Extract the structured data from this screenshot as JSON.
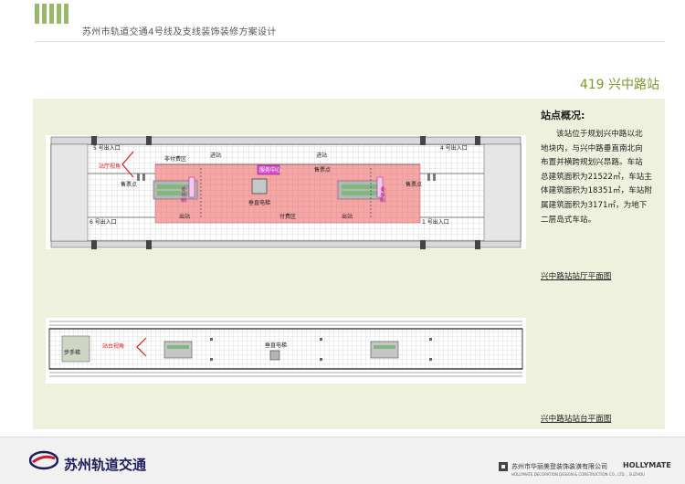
{
  "header": {
    "document_title": "苏州市轨道交通4号线及支线装饰装修方案设计",
    "station_heading": "419  兴中路站"
  },
  "overview": {
    "title": "站点概况:",
    "lines": [
      "该站位于规划兴中路以北",
      "地块内，与兴中路垂直南北向",
      "布置并横跨规划兴昂路。车站",
      "总建筑面积为21522㎡，车站主",
      "体建筑面积为18351㎡，车站附",
      "属建筑面积为3171㎡，为地下",
      "二层岛式车站。"
    ]
  },
  "captions": {
    "concourse": "兴中路站站厅平面图",
    "platform": "兴中路站站台平面图"
  },
  "concourse_plan": {
    "labels": {
      "exit5": "5 号出入口",
      "exit4": "4 号出入口",
      "exit6": "6 号出入口",
      "exit1": "1 号出入口",
      "view": "站厅视角",
      "unpaid": "非付费区",
      "in_left": "进站",
      "in_right": "进站",
      "service": "服务中心",
      "ticket_left": "售票点",
      "ticket_right": "售票点",
      "ticket_mid": "售票点",
      "elevator": "垂直电梯",
      "paid": "付费区",
      "out_left": "出站",
      "out_right": "出站",
      "v_left": "票务亭",
      "v_right": "票务亭"
    }
  },
  "platform_plan": {
    "labels": {
      "view": "站台视角",
      "stair": "步手梯",
      "elevator": "垂直电梯"
    }
  },
  "footer": {
    "logo_text": "苏州轨道交通",
    "company": "苏州市华丽美登装饰装潢有限公司",
    "brand": "HOLLYMATE",
    "company_en": "HOLLYMATE DECORATION DESIGN & CONSTRUCTION CO., LTD. , SUZHOU"
  },
  "colors": {
    "accent_green": "#7c9a2e",
    "panel_bg": "#eef1dd",
    "paid_area": "#f0a0a0",
    "service_magenta": "#d64fd0",
    "view_arrow": "#e01b1b",
    "logo_navy": "#1d1d5e"
  }
}
